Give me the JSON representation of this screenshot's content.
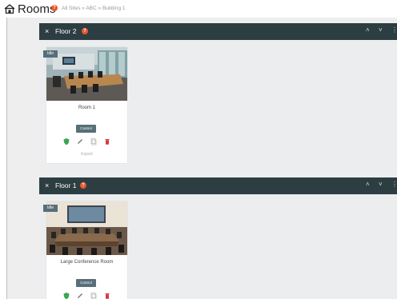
{
  "header": {
    "title": "Rooms",
    "help_badge": "?",
    "breadcrumb": "All Sites » ABC » Building 1",
    "icon": "home-icon"
  },
  "floors": [
    {
      "name": "Floor 2",
      "badge": "?",
      "close": "×",
      "collapse": "˄",
      "expand": "˅",
      "menu": "⋮",
      "room": {
        "status": "Idle",
        "name": "Room 1",
        "control_label": "Control",
        "export_label": "Export",
        "icons": [
          "shield-icon",
          "pencil-icon",
          "copy-icon",
          "trash-icon"
        ]
      }
    },
    {
      "name": "Floor 1",
      "badge": "?",
      "close": "×",
      "collapse": "˄",
      "expand": "˅",
      "menu": "⋮",
      "room": {
        "status": "Idle",
        "name": "Large Conference Room",
        "control_label": "Control",
        "icons": [
          "shield-icon",
          "pencil-icon",
          "copy-icon",
          "trash-icon"
        ]
      }
    }
  ],
  "colors": {
    "floor_bar": "#2d3e43",
    "accent_badge": "#e8572c",
    "control_button": "#586e78",
    "status_green": "#3aa655",
    "delete_red": "#d9363e"
  }
}
